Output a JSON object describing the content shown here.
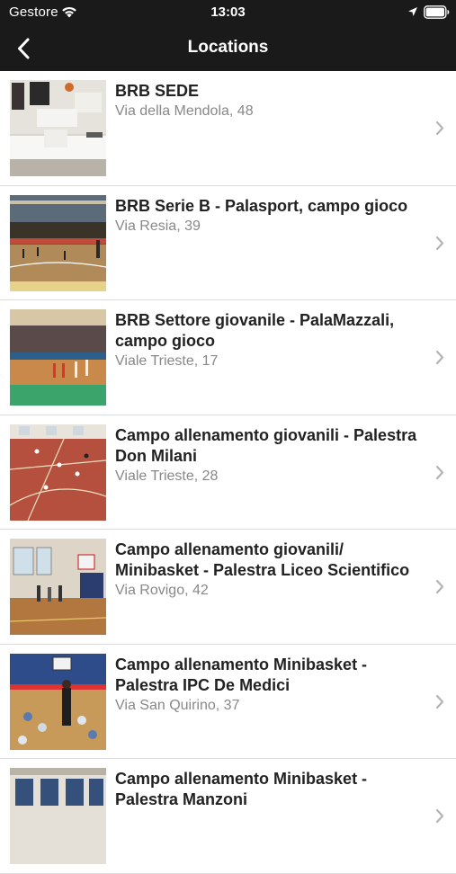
{
  "status_bar": {
    "carrier": "Gestore",
    "time": "13:03"
  },
  "nav": {
    "title": "Locations",
    "back_icon": "chevron-left-icon"
  },
  "locations": [
    {
      "title": "BRB SEDE",
      "address": "Via della Mendola, 48"
    },
    {
      "title": "BRB Serie B - Palasport, campo gioco",
      "address": "Via Resia, 39"
    },
    {
      "title": "BRB Settore giovanile - PalaMazzali, campo gioco",
      "address": "Viale Trieste, 17"
    },
    {
      "title": "Campo allenamento giovanili - Palestra Don Milani",
      "address": "Viale Trieste, 28"
    },
    {
      "title": "Campo allenamento giovanili/ Minibasket - Palestra Liceo Scientifico",
      "address": "Via Rovigo, 42"
    },
    {
      "title": "Campo allenamento Minibasket - Palestra IPC De Medici",
      "address": "Via San Quirino, 37"
    },
    {
      "title": "Campo allenamento Minibasket - Palestra Manzoni",
      "address": ""
    }
  ],
  "colors": {
    "header_bg": "#1a1a1a",
    "title_text": "#222222",
    "address_text": "#888888",
    "chevron": "#b3b3b3"
  }
}
